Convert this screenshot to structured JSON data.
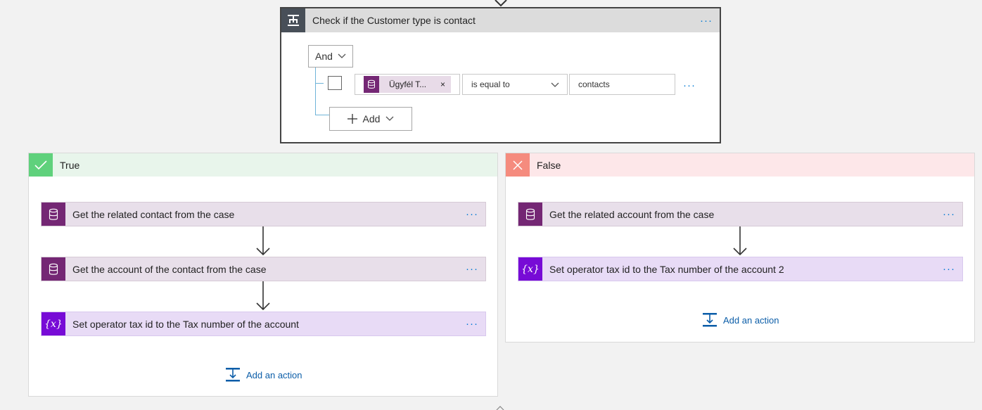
{
  "condition": {
    "title": "Check if the Customer type is contact",
    "group_operator": "And",
    "row": {
      "token_label": "Ügyfél T...",
      "token_remove": "×",
      "operator": "is equal to",
      "value": "contacts"
    },
    "add_label": "Add",
    "more_label": "···"
  },
  "true_branch": {
    "label": "True",
    "actions": [
      {
        "label": "Get the related contact from the case",
        "more": "···"
      },
      {
        "label": "Get the account of the contact from the case",
        "more": "···"
      },
      {
        "label": "Set operator tax id to the Tax number of the account",
        "more": "···",
        "icon_text": "{x}"
      }
    ],
    "add_action": "Add an action"
  },
  "false_branch": {
    "label": "False",
    "actions": [
      {
        "label": "Get the related account from the case",
        "more": "···"
      },
      {
        "label": "Set operator tax id to the Tax number of the account 2",
        "more": "···",
        "icon_text": "{x}"
      }
    ],
    "add_action": "Add an action"
  },
  "colors": {
    "true_accent": "#5fd17c",
    "false_accent": "#f58b7e",
    "data_action": "#742774",
    "variable_action": "#770bd6",
    "link": "#0b5da8"
  }
}
